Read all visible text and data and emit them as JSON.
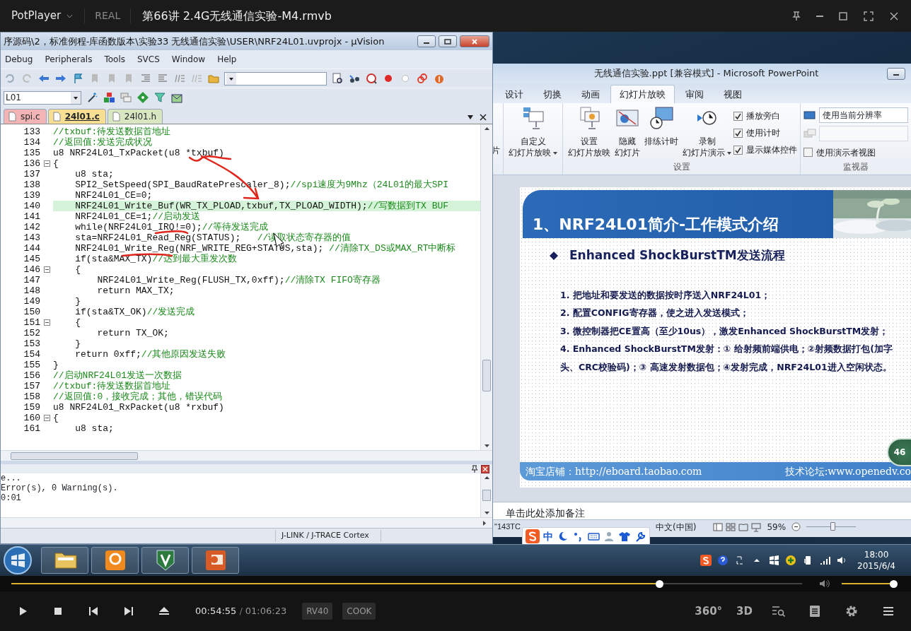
{
  "player": {
    "app_name": "PotPlayer",
    "format": "REAL",
    "file_title": "第66讲 2.4G无线通信实验-M4.rmvb",
    "position": "00:54:55",
    "separator": "/",
    "duration": "01:06:23",
    "progress": {
      "level": 0.82
    },
    "volume": {
      "level": 0.95
    },
    "codecs": [
      "RV40",
      "COOK"
    ],
    "mode_buttons": [
      "360°",
      "3D"
    ]
  },
  "uvision": {
    "title": "序源码\\2，标准例程-库函数版本\\实验33 无线通信实验\\USER\\NRF24L01.uvprojx - µVision",
    "menu": [
      "Debug",
      "Peripherals",
      "Tools",
      "SVCS",
      "Window",
      "Help"
    ],
    "target": "L01",
    "tabs": [
      {
        "label": "spi.c",
        "selected": false,
        "color": "#f2b4b4"
      },
      {
        "label": "24l01.c",
        "selected": true,
        "color": "#f9df93"
      },
      {
        "label": "24l01.h",
        "selected": false,
        "color": "#d8e6c2"
      }
    ],
    "code": [
      {
        "number": "133",
        "comment": "//txbuf:待发送数据首地址",
        "highlighted": false,
        "fold_box": false
      },
      {
        "number": "134",
        "comment": "//返回值:发送完成状况",
        "highlighted": false,
        "fold_box": false
      },
      {
        "number": "135",
        "code": "u8 NRF24L01_TxPacket(u8 *txbuf)",
        "highlighted": false,
        "fold_box": false
      },
      {
        "number": "136",
        "code": "{",
        "highlighted": false,
        "fold_box": true
      },
      {
        "number": "137",
        "code": "    u8 sta;",
        "highlighted": false,
        "fold_box": false
      },
      {
        "number": "138",
        "code": "    SPI2_SetSpeed(SPI_BaudRatePrescaler_8);",
        "comment": "//spi速度为9Mhz（24L01的最大SPI",
        "highlighted": false,
        "fold_box": false
      },
      {
        "number": "139",
        "code": "    NRF24L01_CE=0;",
        "highlighted": false,
        "fold_box": false
      },
      {
        "number": "140",
        "code": "    NRF24L01_Write_Buf(WR_TX_PLOAD,txbuf,TX_PLOAD_WIDTH);",
        "comment": "//写数据到TX BUF",
        "highlighted": true,
        "fold_box": false
      },
      {
        "number": "141",
        "code": "    NRF24L01_CE=1;",
        "comment": "//启动发送",
        "highlighted": false,
        "fold_box": false
      },
      {
        "number": "142",
        "code": "    while(NRF24L01_IRQ!=0);",
        "comment": "//等待发送完成",
        "highlighted": false,
        "fold_box": false
      },
      {
        "number": "143",
        "code": "    sta=NRF24L01_Read_Reg(STATUS);   ",
        "comment": "//读取状态寄存器的值",
        "highlighted": false,
        "fold_box": false
      },
      {
        "number": "144",
        "code": "    NRF24L01_Write_Reg(NRF_WRITE_REG+STATUS,sta); ",
        "comment": "//清除TX_DS或MAX_RT中断标",
        "highlighted": false,
        "fold_box": false
      },
      {
        "number": "145",
        "code": "    if(sta&MAX_TX)",
        "comment": "//达到最大重发次数",
        "highlighted": false,
        "fold_box": false
      },
      {
        "number": "146",
        "code": "    {",
        "highlighted": false,
        "fold_box": true
      },
      {
        "number": "147",
        "code": "        NRF24L01_Write_Reg(FLUSH_TX,0xff);",
        "comment": "//清除TX FIFO寄存器",
        "highlighted": false,
        "fold_box": false
      },
      {
        "number": "148",
        "code": "        return MAX_TX;",
        "highlighted": false,
        "fold_box": false
      },
      {
        "number": "149",
        "code": "    }",
        "highlighted": false,
        "fold_box": false
      },
      {
        "number": "150",
        "code": "    if(sta&TX_OK)",
        "comment": "//发送完成",
        "highlighted": false,
        "fold_box": false
      },
      {
        "number": "151",
        "code": "    {",
        "highlighted": false,
        "fold_box": true
      },
      {
        "number": "152",
        "code": "        return TX_OK;",
        "highlighted": false,
        "fold_box": false
      },
      {
        "number": "153",
        "code": "    }",
        "highlighted": false,
        "fold_box": false
      },
      {
        "number": "154",
        "code": "    return 0xff;",
        "comment": "//其他原因发送失败",
        "highlighted": false,
        "fold_box": false
      },
      {
        "number": "155",
        "code": "}",
        "highlighted": false,
        "fold_box": false
      },
      {
        "number": "156",
        "comment": "//启动NRF24L01发送一次数据",
        "highlighted": false,
        "fold_box": false
      },
      {
        "number": "157",
        "comment": "//txbuf:待发送数据首地址",
        "highlighted": false,
        "fold_box": false
      },
      {
        "number": "158",
        "comment": "//返回值:0，接收完成；其他，错误代码",
        "highlighted": false,
        "fold_box": false
      },
      {
        "number": "159",
        "code": "u8 NRF24L01_RxPacket(u8 *rxbuf)",
        "highlighted": false,
        "fold_box": false
      },
      {
        "number": "160",
        "code": "{",
        "highlighted": false,
        "fold_box": true
      },
      {
        "number": "161",
        "code": "    u8 sta;",
        "highlighted": false,
        "fold_box": false
      }
    ],
    "output": [
      "e...",
      "Error(s), 0 Warning(s).",
      "0:01"
    ],
    "status": "J-LINK / J-TRACE Cortex"
  },
  "powerpoint": {
    "title": "无线通信实验.ppt [兼容模式]  -  Microsoft PowerPoint",
    "tabs": [
      {
        "label": "设计",
        "selected": false
      },
      {
        "label": "切换",
        "selected": false
      },
      {
        "label": "动画",
        "selected": false
      },
      {
        "label": "幻灯片放映",
        "selected": true
      },
      {
        "label": "审阅",
        "selected": false
      },
      {
        "label": "视图",
        "selected": false
      }
    ],
    "ribbon": {
      "cut_label": "片",
      "buttons": [
        {
          "line1": "自定义",
          "line2": "幻灯片放映",
          "dropdown": true
        },
        {
          "line1": "设置",
          "line2": "幻灯片放映",
          "dropdown": false
        },
        {
          "line1": "隐藏",
          "line2": "幻灯片",
          "dropdown": false
        },
        {
          "line1": "排练计时",
          "dropdown": false
        },
        {
          "line1": "录制",
          "line2": "幻灯片演示",
          "dropdown": true
        }
      ],
      "checkboxes": [
        {
          "label": "播放旁白",
          "checked": true
        },
        {
          "label": "使用计时",
          "checked": true
        },
        {
          "label": "显示媒体控件",
          "checked": true
        }
      ],
      "group_label": "设置",
      "resolution": "使用当前分辨率",
      "presenter_view": {
        "label": "使用演示者视图",
        "checked": false
      },
      "monitor_label": "监视器"
    },
    "slide": {
      "title": "1、NRF24L01简介-工作模式介绍",
      "heading": "Enhanced ShockBurstTM发送流程",
      "steps": [
        "1. 把地址和要发送的数据按时序送入NRF24L01；",
        "2. 配置CONFIG寄存器，使之进入发送模式；",
        "3. 微控制器把CE置高（至少10us），激发Enhanced ShockBurstTM发射；",
        "4. Enhanced ShockBurstTM发射：① 给射频前端供电；②射频数据打包(加字头、CRC校验码)；③ 高速发射数据包；④发射完成，NRF24L01进入空闲状态。"
      ],
      "footer_left": "淘宝店铺：http://eboard.taobao.com",
      "footer_right": "技术论坛:www.openedv.co",
      "number": "46"
    },
    "notes_placeholder": "单击此处添加备注",
    "status_text": "\"143TC",
    "language": "中文(中国)",
    "zoom": "59%",
    "zoom_slider": {
      "level": 0.55
    },
    "ime_mode": "中"
  },
  "taskbar": {
    "time": "18:00",
    "date": "2015/6/4"
  }
}
